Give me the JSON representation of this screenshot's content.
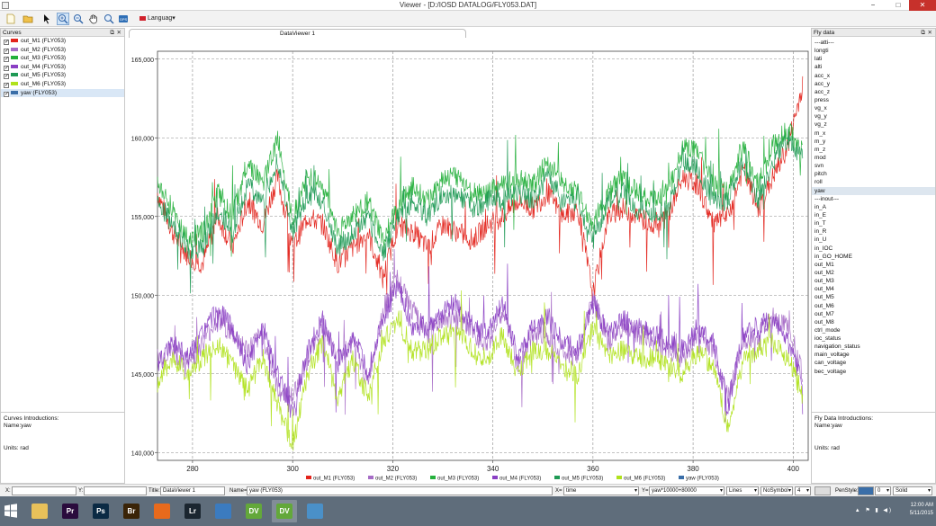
{
  "window": {
    "title": "Viewer - [D:/IOSD DATALOG/FLY053.DAT]",
    "min": "−",
    "max": "□",
    "close": "✕"
  },
  "toolbar": {
    "language_label": "Languag"
  },
  "curves_panel": {
    "title": "Curves",
    "items": [
      {
        "label": "out_M1 (FLY053)",
        "color": "#e3241c",
        "checked": true
      },
      {
        "label": "out_M2 (FLY053)",
        "color": "#a66cc6",
        "checked": true
      },
      {
        "label": "out_M3 (FLY053)",
        "color": "#25b03c",
        "checked": true
      },
      {
        "label": "out_M4 (FLY053)",
        "color": "#8a3fc4",
        "checked": true
      },
      {
        "label": "out_M5 (FLY053)",
        "color": "#1f9a55",
        "checked": true
      },
      {
        "label": "out_M6 (FLY053)",
        "color": "#b0e21c",
        "checked": true
      },
      {
        "label": "yaw (FLY053)",
        "color": "#3a6ea8",
        "checked": true
      }
    ],
    "intro_title": "Curves Introductions:",
    "intro_name": "Name:yaw",
    "intro_units": "Units: rad"
  },
  "fly_panel": {
    "title": "Fly data",
    "items": [
      "---atti---",
      "longti",
      "lati",
      "alti",
      "acc_x",
      "acc_y",
      "acc_z",
      "press",
      "vg_x",
      "vg_y",
      "vg_z",
      "m_x",
      "m_y",
      "m_z",
      "mod",
      "svn",
      "pitch",
      "roll",
      "yaw",
      "---inout---",
      "in_A",
      "in_E",
      "in_T",
      "in_R",
      "in_U",
      "in_IOC",
      "in_GO_HOME",
      "out_M1",
      "out_M2",
      "out_M3",
      "out_M4",
      "out_M5",
      "out_M6",
      "out_M7",
      "out_M8",
      "ctrl_mode",
      "ioc_status",
      "navigation_status",
      "main_voltage",
      "can_voltage",
      "bec_voltage"
    ],
    "selected": "yaw",
    "intro_title": "Fly Data Introductions:",
    "intro_name": "Name:yaw",
    "intro_units": "Units: rad"
  },
  "tab": {
    "label": "DataViewer 1"
  },
  "chart_data": {
    "type": "line",
    "xlim": [
      273,
      403
    ],
    "ylim": [
      139500,
      165500
    ],
    "x_ticks": [
      280,
      300,
      320,
      340,
      360,
      380,
      400
    ],
    "x_tick_labels": [
      "280",
      "300",
      "320",
      "340",
      "360",
      "380",
      "400"
    ],
    "y_ticks": [
      140000,
      145000,
      150000,
      155000,
      160000,
      165000
    ],
    "y_tick_labels": [
      "140,000",
      "145,000",
      "150,000",
      "155,000",
      "160,000",
      "165,000"
    ],
    "grid": true,
    "legend_position": "bottom",
    "x": [
      273,
      276,
      279,
      282,
      285,
      288,
      291,
      294,
      297,
      300,
      303,
      306,
      309,
      312,
      315,
      318,
      321,
      324,
      327,
      330,
      333,
      336,
      339,
      342,
      345,
      348,
      351,
      354,
      357,
      360,
      363,
      366,
      369,
      372,
      375,
      378,
      381,
      384,
      387,
      390,
      393,
      396,
      399,
      402
    ],
    "series": [
      {
        "name": "out_M1 (FLY053)",
        "color": "#e3241c",
        "values": [
          156500,
          154000,
          152500,
          152000,
          155000,
          153000,
          156000,
          154500,
          157500,
          153000,
          155000,
          154500,
          152000,
          153000,
          154000,
          151000,
          154500,
          154000,
          153000,
          154500,
          154000,
          153500,
          154500,
          155000,
          156000,
          155500,
          156500,
          155000,
          155500,
          150000,
          155000,
          155500,
          155000,
          154500,
          155000,
          157500,
          157000,
          154500,
          155000,
          158000,
          155500,
          157500,
          159500,
          163500
        ]
      },
      {
        "name": "out_M2 (FLY053)",
        "color": "#a66cc6",
        "values": [
          146000,
          146500,
          145500,
          147000,
          148500,
          147500,
          146500,
          147500,
          144000,
          143500,
          146000,
          148000,
          146000,
          147000,
          144500,
          149000,
          151000,
          149000,
          147500,
          148500,
          148500,
          147500,
          147000,
          149000,
          145500,
          147500,
          147500,
          146500,
          146000,
          150000,
          147000,
          148000,
          147500,
          147000,
          146500,
          146000,
          147500,
          146500,
          143500,
          147000,
          147500,
          148500,
          148000,
          145000
        ]
      },
      {
        "name": "out_M3 (FLY053)",
        "color": "#25b03c",
        "values": [
          157000,
          155500,
          153500,
          154000,
          156500,
          155000,
          158500,
          157000,
          160000,
          155000,
          157500,
          157000,
          154000,
          155000,
          156000,
          153500,
          155500,
          157000,
          156000,
          157500,
          157500,
          156500,
          156500,
          157000,
          157500,
          157000,
          158500,
          157000,
          156500,
          154500,
          156500,
          157500,
          156500,
          156000,
          156500,
          159500,
          159000,
          157000,
          156500,
          159500,
          157000,
          159500,
          160500,
          159000
        ]
      },
      {
        "name": "out_M4 (FLY053)",
        "color": "#8a3fc4",
        "values": [
          145500,
          147000,
          146000,
          147500,
          149000,
          148000,
          145500,
          148000,
          145000,
          142500,
          146500,
          148500,
          145500,
          147500,
          145000,
          148500,
          150500,
          148000,
          148000,
          149000,
          149500,
          148000,
          147500,
          149500,
          146000,
          148000,
          148500,
          147000,
          146500,
          149500,
          147500,
          148500,
          148000,
          147500,
          147000,
          146500,
          148000,
          147000,
          143000,
          147500,
          148000,
          148500,
          147000,
          144500
        ]
      },
      {
        "name": "out_M5 (FLY053)",
        "color": "#1f9a55",
        "values": [
          156000,
          154500,
          153000,
          153000,
          155500,
          154000,
          157000,
          156000,
          158500,
          154000,
          156500,
          156000,
          153000,
          154000,
          155000,
          152500,
          155000,
          156000,
          155000,
          156500,
          156500,
          155500,
          156000,
          156000,
          156500,
          156000,
          157500,
          156000,
          156000,
          153500,
          156000,
          156500,
          155500,
          155000,
          155500,
          158500,
          158000,
          156000,
          156000,
          158500,
          156000,
          158500,
          160000,
          158500
        ]
      },
      {
        "name": "out_M6 (FLY053)",
        "color": "#b0e21c",
        "values": [
          144500,
          146000,
          145000,
          146000,
          147000,
          145500,
          144000,
          146000,
          143000,
          140500,
          145000,
          147000,
          143500,
          146000,
          143500,
          147000,
          148500,
          146500,
          146500,
          147500,
          147500,
          146500,
          146000,
          147500,
          145000,
          146500,
          146500,
          145500,
          145000,
          148000,
          146000,
          146500,
          146000,
          146000,
          145500,
          145000,
          146500,
          145500,
          141500,
          146000,
          146500,
          147000,
          146000,
          143500
        ]
      },
      {
        "name": "yaw (FLY053)",
        "color": "#3a6ea8",
        "values": []
      }
    ]
  },
  "bottom_bar": {
    "x_label": "X:",
    "y_label": "Y:",
    "title_label": "Title:",
    "title_value": "DataViewer 1",
    "name_label": "Name=",
    "name_value": "yaw (FLY053)",
    "xeq_label": "X=",
    "xeq_value": "time",
    "yeq_label": "Y=",
    "yeq_value": "yaw*10000+80000",
    "style_value": "Lines",
    "symbol_value": "NoSymbol",
    "width_value": "4",
    "penstyle_label": "PenStyle:",
    "pen_width_value": "0",
    "line_style_value": "Solid",
    "pen_color": "#3a6ea8"
  },
  "taskbar": {
    "apps": [
      {
        "name": "file-explorer",
        "label": "",
        "bg": "#e9c15a"
      },
      {
        "name": "premiere",
        "label": "Pr",
        "bg": "#2a0b3d"
      },
      {
        "name": "photoshop",
        "label": "Ps",
        "bg": "#0b2a44"
      },
      {
        "name": "bridge",
        "label": "Br",
        "bg": "#3a2408"
      },
      {
        "name": "firefox",
        "label": "",
        "bg": "#e86a1c"
      },
      {
        "name": "lightroom",
        "label": "Lr",
        "bg": "#1b2630"
      },
      {
        "name": "network",
        "label": "",
        "bg": "#3b7bbf"
      },
      {
        "name": "dv-1",
        "label": "DV",
        "bg": "#63a83a"
      },
      {
        "name": "dv-2",
        "label": "DV",
        "bg": "#63a83a"
      },
      {
        "name": "window",
        "label": "",
        "bg": "#4a90c8"
      }
    ],
    "time": "12:00 AM",
    "date": "5/11/2015"
  }
}
